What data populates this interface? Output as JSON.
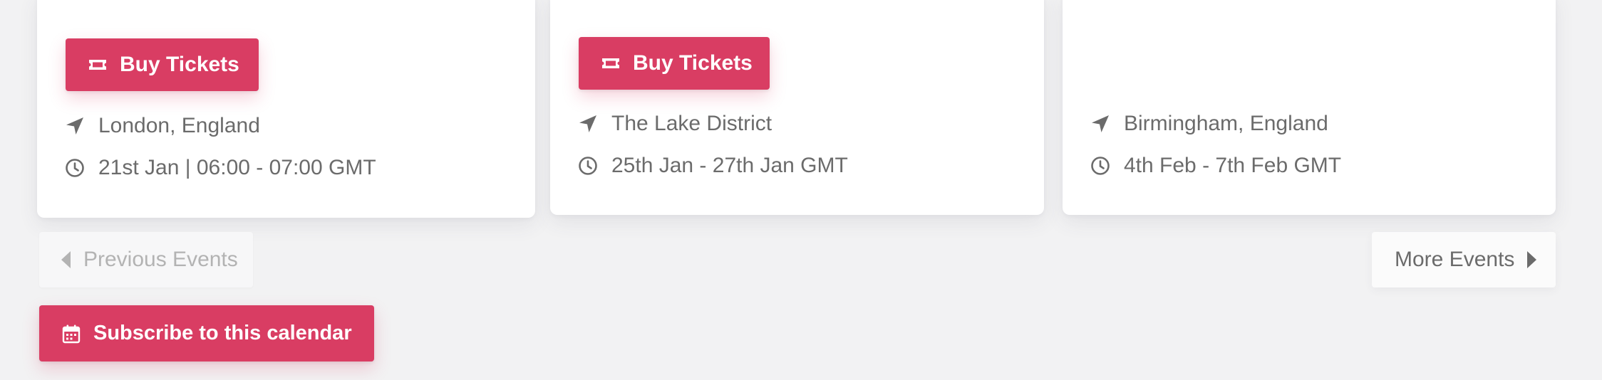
{
  "events": [
    {
      "buy_label": "Buy Tickets",
      "location": "London, England",
      "time": "21st Jan | 06:00 - 07:00 GMT"
    },
    {
      "buy_label": "Buy Tickets",
      "location": "The Lake District",
      "time": "25th Jan - 27th Jan GMT"
    },
    {
      "location": "Birmingham, England",
      "time": "4th Feb - 7th Feb GMT"
    }
  ],
  "pagination": {
    "previous_label": "Previous Events",
    "next_label": "More Events"
  },
  "subscribe": {
    "label": "Subscribe to this calendar"
  },
  "icons": {
    "ticket": "ticket-icon",
    "location": "location-arrow-icon",
    "clock": "clock-icon",
    "calendar": "calendar-icon",
    "caret_left": "caret-left-icon",
    "caret_right": "caret-right-icon"
  },
  "colors": {
    "accent": "#d93d63",
    "background": "#f2f2f3",
    "card": "#ffffff",
    "meta_text": "#6b6b6b",
    "disabled_text": "#b3b3b3"
  }
}
